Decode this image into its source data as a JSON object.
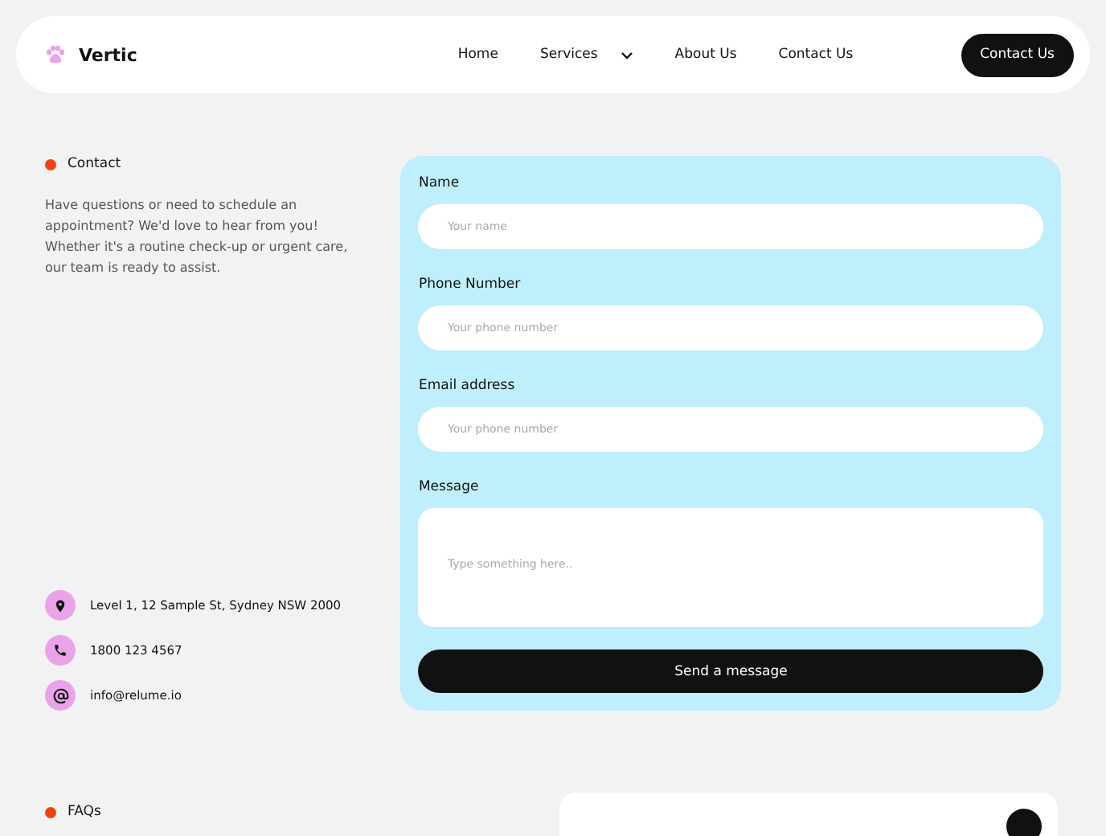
{
  "nav": {
    "brand": "Vertic",
    "links": [
      {
        "label": "Home",
        "has_menu": false
      },
      {
        "label": "Services",
        "has_menu": true
      },
      {
        "label": "About Us",
        "has_menu": false
      },
      {
        "label": "Contact Us",
        "has_menu": false
      }
    ],
    "cta": "Contact Us"
  },
  "contact": {
    "eyebrow": "Contact",
    "intro": [
      "Have questions or need to schedule an appointment? We'd love to hear from you!",
      "Whether it's a routine check-up or urgent care, our team is ready to assist."
    ],
    "details": [
      {
        "kind": "location",
        "text": "Level 1, 12 Sample St, Sydney NSW 2000"
      },
      {
        "kind": "phone",
        "text": "1800 123 4567"
      },
      {
        "kind": "email",
        "text": "info@relume.io"
      }
    ]
  },
  "form": {
    "fields": [
      {
        "kind": "input",
        "label": "Name",
        "placeholder": "Your name"
      },
      {
        "kind": "input",
        "label": "Phone Number",
        "placeholder": "Your phone number"
      },
      {
        "kind": "input",
        "label": "Email address",
        "placeholder": "Your phone number"
      },
      {
        "kind": "textarea",
        "label": "Message",
        "placeholder": "Type something here.."
      }
    ],
    "submit": "Send a message"
  },
  "faqs": {
    "eyebrow": "FAQs"
  }
}
